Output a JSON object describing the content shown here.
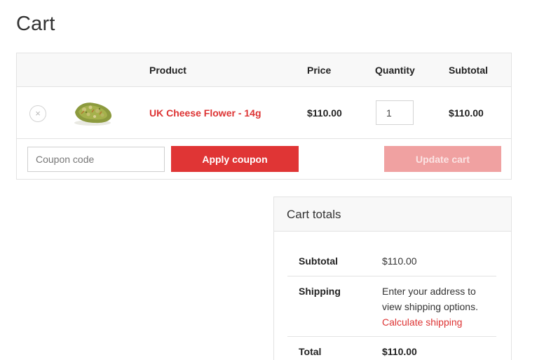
{
  "page": {
    "title": "Cart"
  },
  "cart_table": {
    "headers": {
      "product": "Product",
      "price": "Price",
      "quantity": "Quantity",
      "subtotal": "Subtotal"
    },
    "items": [
      {
        "remove_symbol": "×",
        "thumbnail": "cannabis-bud-image",
        "name": "UK Cheese Flower - 14g",
        "price": "$110.00",
        "quantity": "1",
        "subtotal": "$110.00"
      }
    ]
  },
  "actions": {
    "coupon_placeholder": "Coupon code",
    "apply_label": "Apply coupon",
    "update_label": "Update cart"
  },
  "totals": {
    "title": "Cart totals",
    "subtotal_label": "Subtotal",
    "subtotal_value": "$110.00",
    "shipping_label": "Shipping",
    "shipping_text": "Enter your address to view shipping options.",
    "shipping_link": "Calculate shipping",
    "total_label": "Total",
    "total_value": "$110.00"
  },
  "colors": {
    "accent": "#dd3333",
    "button": "#e03535",
    "button_disabled": "#f0a1a1",
    "border": "#e3e3e3"
  }
}
